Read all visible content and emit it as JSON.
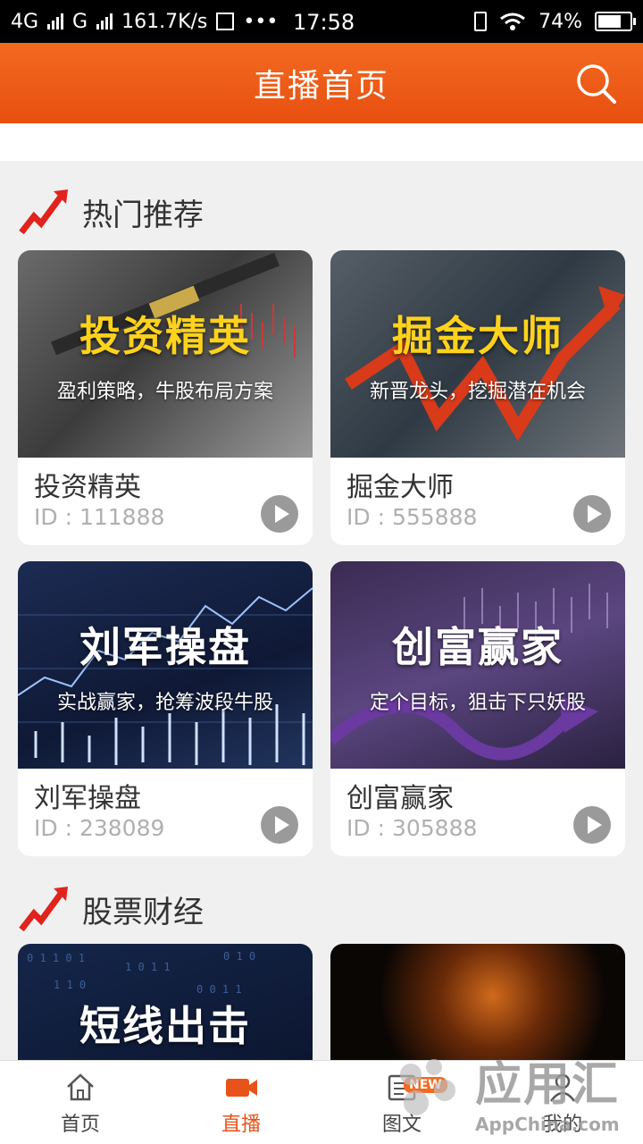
{
  "status_bar": {
    "network_1": "4G",
    "network_2": "G",
    "speed": "161.7K/s",
    "time": "17:58",
    "battery": "74%",
    "battery_level": 0.74
  },
  "header": {
    "title": "直播首页"
  },
  "sections": [
    {
      "title": "热门推荐",
      "cards": [
        {
          "banner_title": "投资精英",
          "banner_subtitle": "盈利策略，牛股布局方案",
          "name": "投资精英",
          "id_text": "ID : 111888"
        },
        {
          "banner_title": "掘金大师",
          "banner_subtitle": "新晋龙头，挖掘潜在机会",
          "name": "掘金大师",
          "id_text": "ID : 555888"
        },
        {
          "banner_title": "刘军操盘",
          "banner_subtitle": "实战赢家，抢筹波段牛股",
          "name": "刘军操盘",
          "id_text": "ID : 238089"
        },
        {
          "banner_title": "创富赢家",
          "banner_subtitle": "定个目标，狙击下只妖股",
          "name": "创富赢家",
          "id_text": "ID : 305888"
        }
      ]
    },
    {
      "title": "股票财经",
      "cards": [
        {
          "banner_title": "短线出击"
        },
        {
          "banner_title": ""
        }
      ]
    }
  ],
  "tabbar": [
    {
      "label": "首页",
      "icon": "home-icon"
    },
    {
      "label": "直播",
      "icon": "video-camera-icon"
    },
    {
      "label": "图文",
      "icon": "article-icon",
      "badge": "NEW"
    },
    {
      "label": "我的",
      "icon": "user-icon"
    }
  ],
  "watermark": {
    "cn": "应用汇",
    "en": "AppChina.com"
  },
  "colors": {
    "accent": "#e8531a",
    "header": "#f36a21",
    "play": "#9a9a9a"
  }
}
